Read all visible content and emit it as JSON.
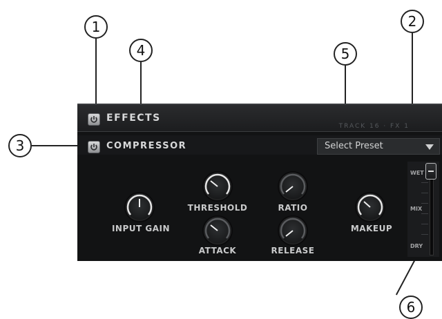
{
  "callouts": [
    "1",
    "2",
    "3",
    "4",
    "5",
    "6"
  ],
  "effects": {
    "title": "EFFECTS",
    "track_label": "TRACK 16 · FX 1"
  },
  "compressor": {
    "title": "COMPRESSOR",
    "preset_value": "Select Preset"
  },
  "knobs": {
    "input_gain": "INPUT GAIN",
    "threshold": "THRESHOLD",
    "ratio": "RATIO",
    "attack": "ATTACK",
    "release": "RELEASE",
    "makeup": "MAKEUP"
  },
  "mix": {
    "wet": "WET",
    "mix": "MIX",
    "dry": "DRY",
    "level": 1.0
  },
  "colors": {
    "panel": "#121314",
    "knob_arc": "#e6e6e6",
    "text": "#d8d9da"
  },
  "icons": [
    "power-icon",
    "dropdown-arrow-icon"
  ]
}
